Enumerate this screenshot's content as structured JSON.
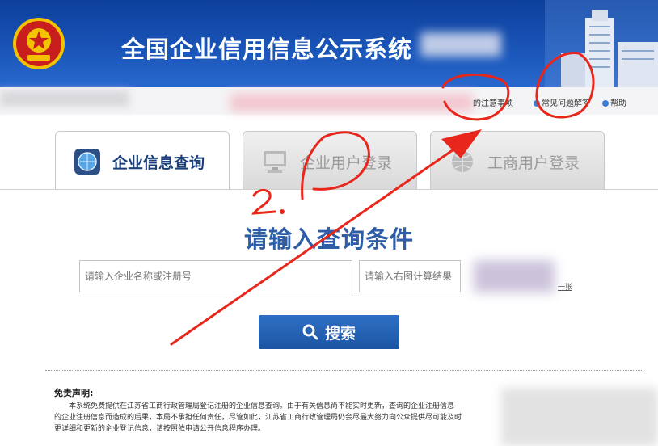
{
  "header": {
    "title": "全国企业信用信息公示系统"
  },
  "top_links": {
    "notice": "的注意事项",
    "faq": "常见问题解答",
    "help": "帮助"
  },
  "tabs": [
    {
      "label": "企业信息查询",
      "icon": "monitor-globe-icon"
    },
    {
      "label": "企业用户登录",
      "icon": "computer-icon"
    },
    {
      "label": "工商用户登录",
      "icon": "globe-icon"
    }
  ],
  "search": {
    "heading": "请输入查询条件",
    "name_placeholder": "请输入企业名称或注册号",
    "captcha_placeholder": "请输入右图计算结果",
    "refresh_text": "一张",
    "button_label": "搜索"
  },
  "disclaimer": {
    "title": "免责声明:",
    "lines": [
      "本系统免费提供在江苏省工商行政管理局登记注册的企业信息查询。由于有关信息尚不能实时更新，查询的企业注册信息",
      "的企业注册信息而造成的后果，本局不承担任何责任，尽管如此，江苏省工商行政管理局仍会尽最大努力向公众提供尽可能及时",
      "更详细和更新的企业登记信息，请按照依申请公开信息程序办理。"
    ]
  },
  "annotations": {
    "step_label": "2."
  },
  "colors": {
    "header_blue": "#1a55b8",
    "heading_blue": "#2f5ea8",
    "annotation_red": "#e8261c"
  }
}
